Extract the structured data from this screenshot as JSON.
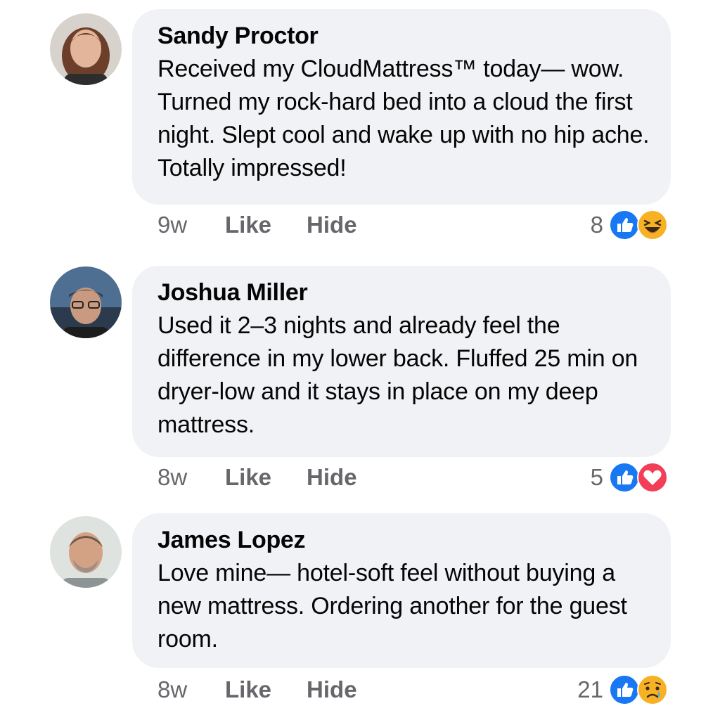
{
  "comments": [
    {
      "author": "Sandy Proctor",
      "text": "Received my CloudMattress™ today— wow. Turned my rock-hard bed into a cloud the first night. Slept cool and wake up with no hip ache. Totally impressed!",
      "time": "9w",
      "like_label": "Like",
      "hide_label": "Hide",
      "reaction_count": "8",
      "reactions": [
        "like-icon",
        "laughing-emoji-icon"
      ]
    },
    {
      "author": "Joshua Miller",
      "text": "Used it 2–3  nights and already feel the difference in my lower back. Fluffed 25 min on dryer-low and it stays in place on my deep mattress.",
      "time": "8w",
      "like_label": "Like",
      "hide_label": "Hide",
      "reaction_count": "5",
      "reactions": [
        "like-icon",
        "love-icon"
      ]
    },
    {
      "author": "James Lopez",
      "text": "Love mine— hotel-soft feel without buying a new mattress. Ordering another for the guest room.",
      "time": "8w",
      "like_label": "Like",
      "hide_label": "Hide",
      "reaction_count": "21",
      "reactions": [
        "like-icon",
        "sad-emoji-icon"
      ]
    }
  ],
  "colors": {
    "bubble": "#f0f2f5",
    "like_blue": "#1877f2",
    "love_red": "#f33e58",
    "emoji_yellow": "#f7b125",
    "meta_gray": "#65676b"
  }
}
